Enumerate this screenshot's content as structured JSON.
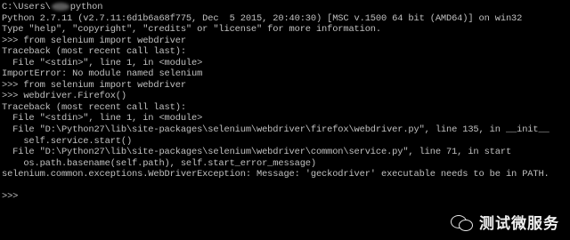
{
  "console": {
    "prompt_prefix": "C:\\Users\\",
    "prompt_suffix": "python",
    "lines": [
      "Python 2.7.11 (v2.7.11:6d1b6a68f775, Dec  5 2015, 20:40:30) [MSC v.1500 64 bit (AMD64)] on win32",
      "Type \"help\", \"copyright\", \"credits\" or \"license\" for more information.",
      ">>> from selenium import webdriver",
      "Traceback (most recent call last):",
      "  File \"<stdin>\", line 1, in <module>",
      "ImportError: No module named selenium",
      ">>> from selenium import webdriver",
      ">>> webdriver.Firefox()",
      "Traceback (most recent call last):",
      "  File \"<stdin>\", line 1, in <module>",
      "  File \"D:\\Python27\\lib\\site-packages\\selenium\\webdriver\\firefox\\webdriver.py\", line 135, in __init__",
      "    self.service.start()",
      "  File \"D:\\Python27\\lib\\site-packages\\selenium\\webdriver\\common\\service.py\", line 71, in start",
      "    os.path.basename(self.path), self.start_error_message)",
      "selenium.common.exceptions.WebDriverException: Message: 'geckodriver' executable needs to be in PATH.",
      "",
      ">>>"
    ]
  },
  "watermark": {
    "icon": "wechat-icon",
    "text": "测试微服务"
  }
}
